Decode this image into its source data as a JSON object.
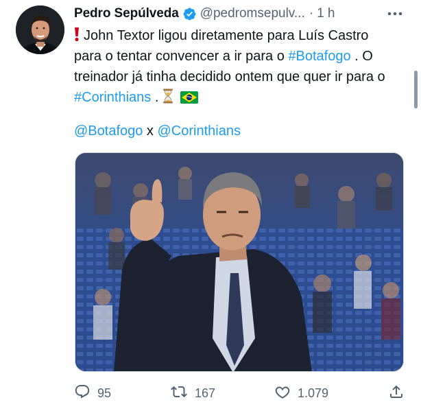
{
  "tweet": {
    "author": {
      "name": "Pedro Sepúlveda",
      "handle": "@pedromsepulv...",
      "separator": "·",
      "time": "1 h",
      "verified": true
    },
    "text": {
      "part1": "John Textor ligou diretamente para Luís Castro para o tentar convencer a ir para o ",
      "hashtag1": "#Botafogo",
      "part2": " . O treinador já tinha decidido ontem que quer ir para o ",
      "hashtag2": "#Corinthians",
      "part3": " . "
    },
    "mentions": {
      "first": "@Botafogo",
      "joiner": " x ",
      "second": "@Corinthians"
    },
    "stats": {
      "replies": "95",
      "retweets": "167",
      "likes": "1.079"
    }
  },
  "icons": {
    "verified": "verified-badge-icon",
    "more": "more-dots-icon",
    "reply": "reply-icon",
    "retweet": "retweet-icon",
    "like": "heart-icon",
    "share": "share-icon",
    "exclamation": "red-exclamation-emoji",
    "hourglass": "hourglass-emoji",
    "flag": "brazil-flag-emoji"
  },
  "colors": {
    "link": "#1d9bf0",
    "secondary_text": "#536471",
    "primary_text": "#0f1419",
    "verified_badge": "#1d9bf0"
  }
}
